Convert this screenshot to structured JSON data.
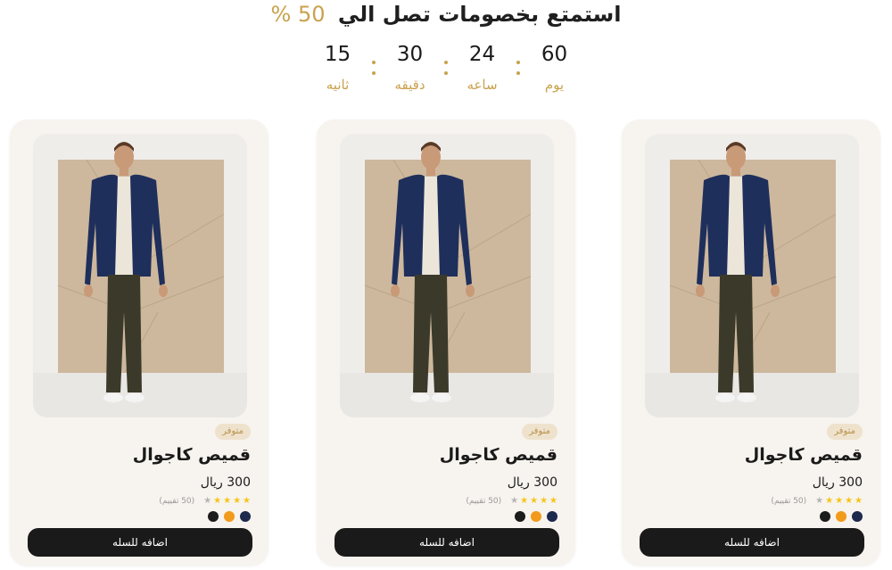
{
  "promo": {
    "headline": "استمتع بخصومات تصل الي",
    "discount": "50 %"
  },
  "countdown": [
    {
      "value": "60",
      "label": "يوم"
    },
    {
      "value": "24",
      "label": "ساعه"
    },
    {
      "value": "30",
      "label": "دقيقه"
    },
    {
      "value": "15",
      "label": "ثانيه"
    }
  ],
  "products": [
    {
      "badge": "متوفر",
      "name": "قميص كاجوال",
      "price": "300 ريال",
      "rating_text": "(50 تقييم)",
      "stars": 4,
      "colors": [
        "#1d2a4d",
        "#f29a1b",
        "#1c1c1c"
      ],
      "cta": "اضافه للسله"
    },
    {
      "badge": "متوفر",
      "name": "قميص كاجوال",
      "price": "300 ريال",
      "rating_text": "(50 تقييم)",
      "stars": 4,
      "colors": [
        "#1d2a4d",
        "#f29a1b",
        "#1c1c1c"
      ],
      "cta": "اضافه للسله"
    },
    {
      "badge": "متوفر",
      "name": "قميص كاجوال",
      "price": "300 ريال",
      "rating_text": "(50 تقييم)",
      "stars": 4,
      "colors": [
        "#1d2a4d",
        "#f29a1b",
        "#1c1c1c"
      ],
      "cta": "اضافه للسله"
    }
  ],
  "theme": {
    "accent": "#c9a24e",
    "button_bg": "#1a1a1a",
    "card_bg": "#f7f3ee"
  }
}
